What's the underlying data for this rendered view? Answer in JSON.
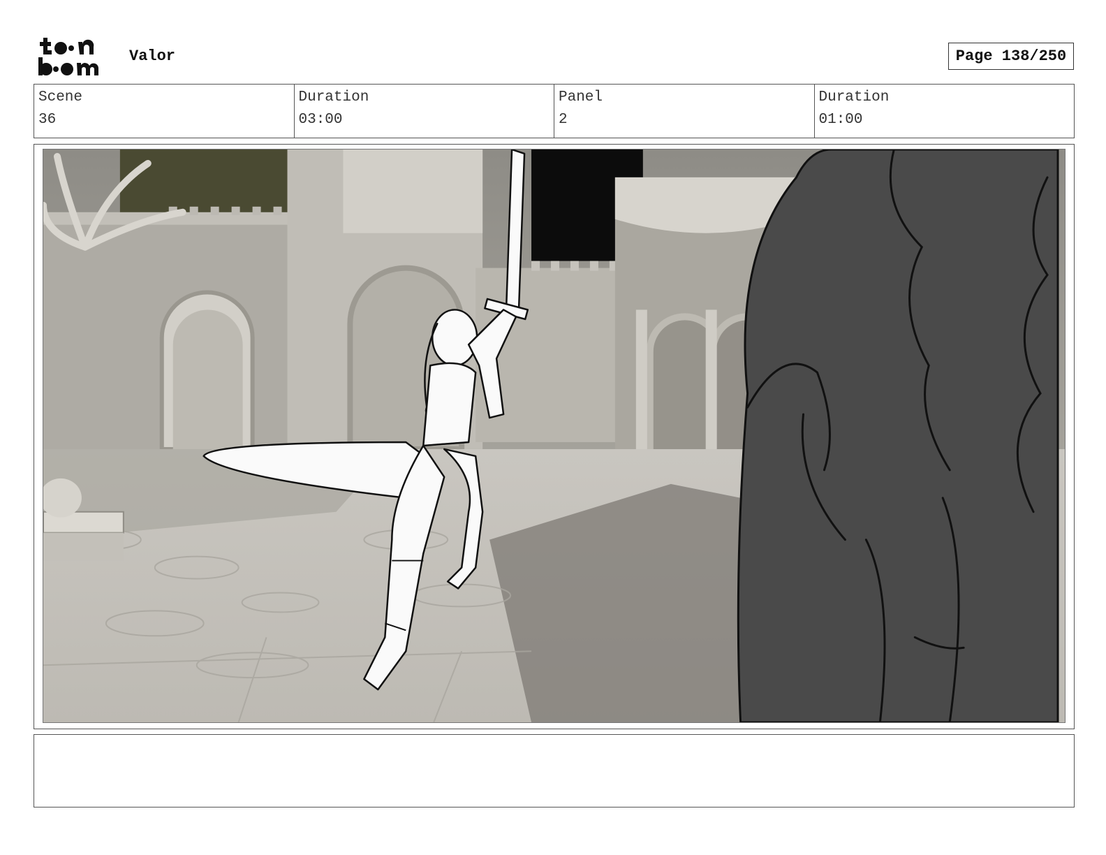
{
  "header": {
    "logo_text": "toon boom",
    "project_title": "Valor",
    "page_label": "Page 138/250"
  },
  "info": {
    "scene_label": "Scene",
    "scene_value": "36",
    "scene_duration_label": "Duration",
    "scene_duration_value": "03:00",
    "panel_label": "Panel",
    "panel_value": "2",
    "panel_duration_label": "Duration",
    "panel_duration_value": "01:00"
  },
  "notes": {
    "text": ""
  }
}
